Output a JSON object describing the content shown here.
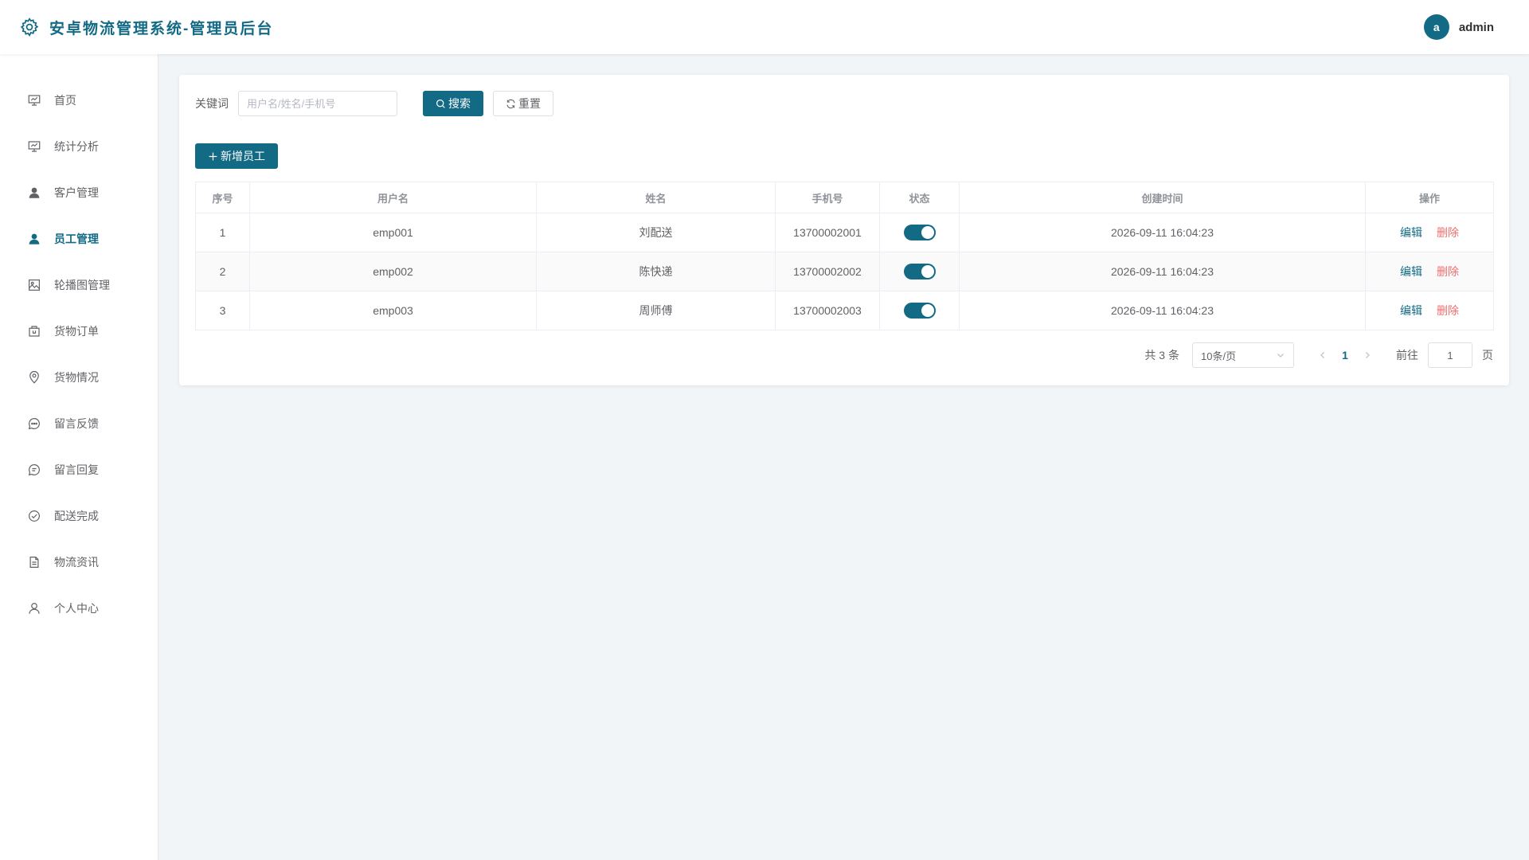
{
  "header": {
    "title": "安卓物流管理系统-管理员后台",
    "avatar_letter": "a",
    "username": "admin"
  },
  "sidebar": {
    "items": [
      {
        "label": "首页",
        "icon": "presentation-icon"
      },
      {
        "label": "统计分析",
        "icon": "presentation-icon"
      },
      {
        "label": "客户管理",
        "icon": "user-filled-icon"
      },
      {
        "label": "员工管理",
        "icon": "user-filled-icon",
        "active": true
      },
      {
        "label": "轮播图管理",
        "icon": "picture-icon"
      },
      {
        "label": "货物订单",
        "icon": "box-icon"
      },
      {
        "label": "货物情况",
        "icon": "location-icon"
      },
      {
        "label": "留言反馈",
        "icon": "chat-dots-icon"
      },
      {
        "label": "留言回复",
        "icon": "chat-lines-icon"
      },
      {
        "label": "配送完成",
        "icon": "circle-check-icon"
      },
      {
        "label": "物流资讯",
        "icon": "document-icon"
      },
      {
        "label": "个人中心",
        "icon": "user-icon"
      }
    ]
  },
  "search": {
    "label": "关键词",
    "placeholder": "用户名/姓名/手机号",
    "value": "",
    "search_button": "搜索",
    "reset_button": "重置"
  },
  "toolbar": {
    "add_button": "新增员工"
  },
  "table": {
    "columns": [
      "序号",
      "用户名",
      "姓名",
      "手机号",
      "状态",
      "创建时间",
      "操作"
    ],
    "rows": [
      {
        "index": "1",
        "username": "emp001",
        "name": "刘配送",
        "phone": "13700002001",
        "status_on": true,
        "created": "2026-09-11 16:04:23",
        "edit": "编辑",
        "delete": "删除"
      },
      {
        "index": "2",
        "username": "emp002",
        "name": "陈快递",
        "phone": "13700002002",
        "status_on": true,
        "created": "2026-09-11 16:04:23",
        "edit": "编辑",
        "delete": "删除"
      },
      {
        "index": "3",
        "username": "emp003",
        "name": "周师傅",
        "phone": "13700002003",
        "status_on": true,
        "created": "2026-09-11 16:04:23",
        "edit": "编辑",
        "delete": "删除"
      }
    ]
  },
  "pagination": {
    "total": "共 3 条",
    "page_size": "10条/页",
    "current_page": "1",
    "goto_label": "前往",
    "goto_value": "1",
    "page_suffix": "页"
  },
  "colors": {
    "primary": "#136a85",
    "danger": "#f56c6c",
    "background": "#f2f5f8"
  }
}
